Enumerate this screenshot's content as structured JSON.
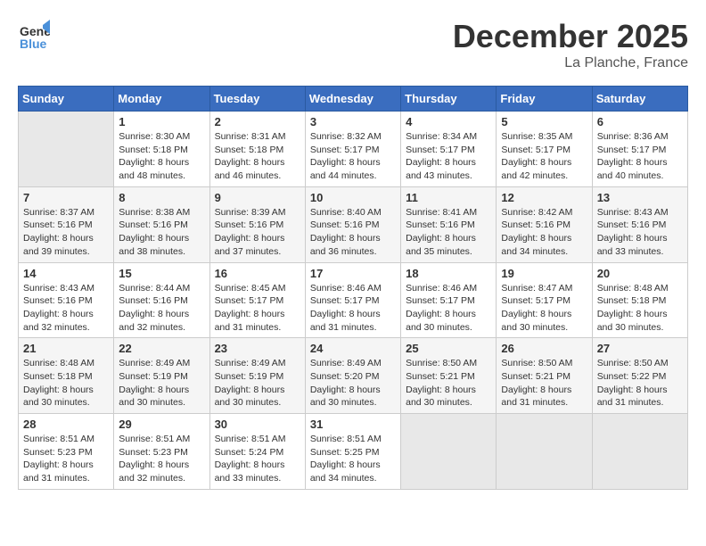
{
  "header": {
    "logo_line1": "General",
    "logo_line2": "Blue",
    "month": "December 2025",
    "location": "La Planche, France"
  },
  "weekdays": [
    "Sunday",
    "Monday",
    "Tuesday",
    "Wednesday",
    "Thursday",
    "Friday",
    "Saturday"
  ],
  "weeks": [
    [
      {
        "day": "",
        "empty": true
      },
      {
        "day": "1",
        "sunrise": "8:30 AM",
        "sunset": "5:18 PM",
        "daylight": "8 hours and 48 minutes."
      },
      {
        "day": "2",
        "sunrise": "8:31 AM",
        "sunset": "5:18 PM",
        "daylight": "8 hours and 46 minutes."
      },
      {
        "day": "3",
        "sunrise": "8:32 AM",
        "sunset": "5:17 PM",
        "daylight": "8 hours and 44 minutes."
      },
      {
        "day": "4",
        "sunrise": "8:34 AM",
        "sunset": "5:17 PM",
        "daylight": "8 hours and 43 minutes."
      },
      {
        "day": "5",
        "sunrise": "8:35 AM",
        "sunset": "5:17 PM",
        "daylight": "8 hours and 42 minutes."
      },
      {
        "day": "6",
        "sunrise": "8:36 AM",
        "sunset": "5:17 PM",
        "daylight": "8 hours and 40 minutes."
      }
    ],
    [
      {
        "day": "7",
        "sunrise": "8:37 AM",
        "sunset": "5:16 PM",
        "daylight": "8 hours and 39 minutes."
      },
      {
        "day": "8",
        "sunrise": "8:38 AM",
        "sunset": "5:16 PM",
        "daylight": "8 hours and 38 minutes."
      },
      {
        "day": "9",
        "sunrise": "8:39 AM",
        "sunset": "5:16 PM",
        "daylight": "8 hours and 37 minutes."
      },
      {
        "day": "10",
        "sunrise": "8:40 AM",
        "sunset": "5:16 PM",
        "daylight": "8 hours and 36 minutes."
      },
      {
        "day": "11",
        "sunrise": "8:41 AM",
        "sunset": "5:16 PM",
        "daylight": "8 hours and 35 minutes."
      },
      {
        "day": "12",
        "sunrise": "8:42 AM",
        "sunset": "5:16 PM",
        "daylight": "8 hours and 34 minutes."
      },
      {
        "day": "13",
        "sunrise": "8:43 AM",
        "sunset": "5:16 PM",
        "daylight": "8 hours and 33 minutes."
      }
    ],
    [
      {
        "day": "14",
        "sunrise": "8:43 AM",
        "sunset": "5:16 PM",
        "daylight": "8 hours and 32 minutes."
      },
      {
        "day": "15",
        "sunrise": "8:44 AM",
        "sunset": "5:16 PM",
        "daylight": "8 hours and 32 minutes."
      },
      {
        "day": "16",
        "sunrise": "8:45 AM",
        "sunset": "5:17 PM",
        "daylight": "8 hours and 31 minutes."
      },
      {
        "day": "17",
        "sunrise": "8:46 AM",
        "sunset": "5:17 PM",
        "daylight": "8 hours and 31 minutes."
      },
      {
        "day": "18",
        "sunrise": "8:46 AM",
        "sunset": "5:17 PM",
        "daylight": "8 hours and 30 minutes."
      },
      {
        "day": "19",
        "sunrise": "8:47 AM",
        "sunset": "5:17 PM",
        "daylight": "8 hours and 30 minutes."
      },
      {
        "day": "20",
        "sunrise": "8:48 AM",
        "sunset": "5:18 PM",
        "daylight": "8 hours and 30 minutes."
      }
    ],
    [
      {
        "day": "21",
        "sunrise": "8:48 AM",
        "sunset": "5:18 PM",
        "daylight": "8 hours and 30 minutes."
      },
      {
        "day": "22",
        "sunrise": "8:49 AM",
        "sunset": "5:19 PM",
        "daylight": "8 hours and 30 minutes."
      },
      {
        "day": "23",
        "sunrise": "8:49 AM",
        "sunset": "5:19 PM",
        "daylight": "8 hours and 30 minutes."
      },
      {
        "day": "24",
        "sunrise": "8:49 AM",
        "sunset": "5:20 PM",
        "daylight": "8 hours and 30 minutes."
      },
      {
        "day": "25",
        "sunrise": "8:50 AM",
        "sunset": "5:21 PM",
        "daylight": "8 hours and 30 minutes."
      },
      {
        "day": "26",
        "sunrise": "8:50 AM",
        "sunset": "5:21 PM",
        "daylight": "8 hours and 31 minutes."
      },
      {
        "day": "27",
        "sunrise": "8:50 AM",
        "sunset": "5:22 PM",
        "daylight": "8 hours and 31 minutes."
      }
    ],
    [
      {
        "day": "28",
        "sunrise": "8:51 AM",
        "sunset": "5:23 PM",
        "daylight": "8 hours and 31 minutes."
      },
      {
        "day": "29",
        "sunrise": "8:51 AM",
        "sunset": "5:23 PM",
        "daylight": "8 hours and 32 minutes."
      },
      {
        "day": "30",
        "sunrise": "8:51 AM",
        "sunset": "5:24 PM",
        "daylight": "8 hours and 33 minutes."
      },
      {
        "day": "31",
        "sunrise": "8:51 AM",
        "sunset": "5:25 PM",
        "daylight": "8 hours and 34 minutes."
      },
      {
        "day": "",
        "empty": true
      },
      {
        "day": "",
        "empty": true
      },
      {
        "day": "",
        "empty": true
      }
    ]
  ]
}
